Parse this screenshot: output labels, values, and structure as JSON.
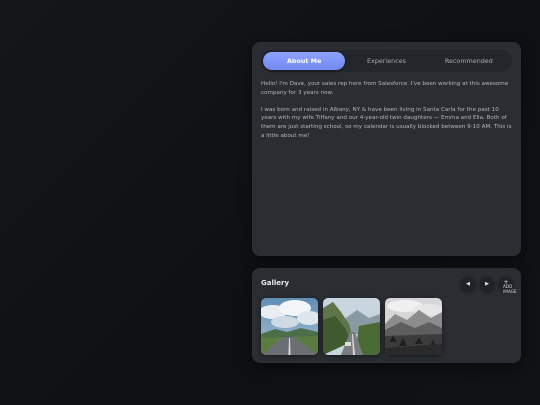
{
  "tabs": [
    {
      "label": "About Me",
      "active": true
    },
    {
      "label": "Experiences",
      "active": false
    },
    {
      "label": "Recommended",
      "active": false
    }
  ],
  "about": {
    "paragraph_1": "Hello! I'm Dave, your sales rep here from Salesforce. I've been working at this awesome company for 3 years now.",
    "paragraph_2": "I was born and raised in Albany, NY & have been living in Santa Carla for the past 10 years with my wife Tiffany and our 4-year-old twin daughters — Emma and Ella. Both of them are just starting school, so my calendar is usually blocked between 9-10 AM. This is a little about me!"
  },
  "gallery": {
    "title": "Gallery",
    "prev_icon": "◀",
    "next_icon": "▶",
    "add_icon": "+",
    "add_label": "ADD IMAGE",
    "images": [
      {
        "name": "road-clouds"
      },
      {
        "name": "mountain-road"
      },
      {
        "name": "bw-mountain-valley"
      }
    ]
  },
  "colors": {
    "accent": "#7d92fb",
    "card": "#2a2d32",
    "background": "#111316"
  }
}
